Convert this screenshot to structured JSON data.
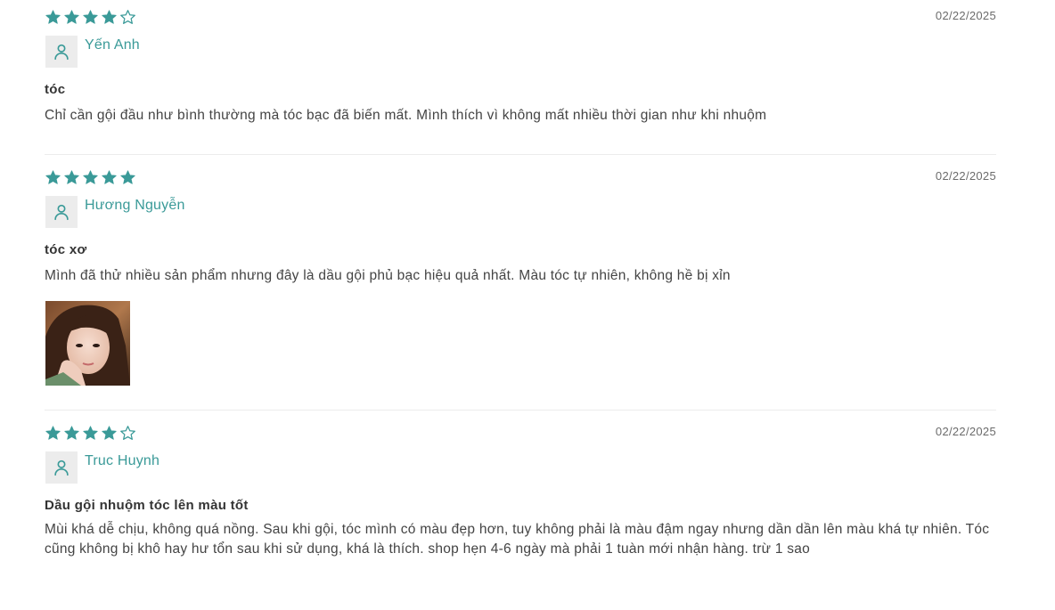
{
  "colors": {
    "accent": "#3a9a98",
    "star": "#3a9a98",
    "avatar_bg": "#ececec",
    "divider": "#ececec"
  },
  "reviews": [
    {
      "rating": 4,
      "date": "02/22/2025",
      "author": "Yến Anh",
      "title": "tóc",
      "body": "Chỉ cần gội đầu như bình thường mà tóc bạc đã biến mất. Mình thích vì không mất nhiều thời gian như khi nhuộm",
      "avatar_icon": "user-icon"
    },
    {
      "rating": 5,
      "date": "02/22/2025",
      "author": "Hương Nguyễn",
      "title": "tóc xơ",
      "body": "Mình đã thử nhiều sản phẩm nhưng đây là dầu gội phủ bạc hiệu quả nhất. Màu tóc tự nhiên, không hề bị xỉn",
      "avatar_icon": "user-icon",
      "photo": "review-photo"
    },
    {
      "rating": 4,
      "date": "02/22/2025",
      "author": "Truc Huynh",
      "title": "Dầu gội nhuộm tóc lên màu tốt",
      "body": "Mùi khá dễ chịu, không quá nồng. Sau khi gội, tóc mình có màu đẹp hơn, tuy không phải là màu đậm ngay nhưng dần dần lên màu khá tự nhiên. Tóc cũng không bị khô hay hư tổn sau khi sử dụng, khá là thích. shop hẹn 4-6 ngày mà phải 1 tuàn mới nhận hàng. trừ 1 sao",
      "avatar_icon": "user-icon"
    }
  ]
}
